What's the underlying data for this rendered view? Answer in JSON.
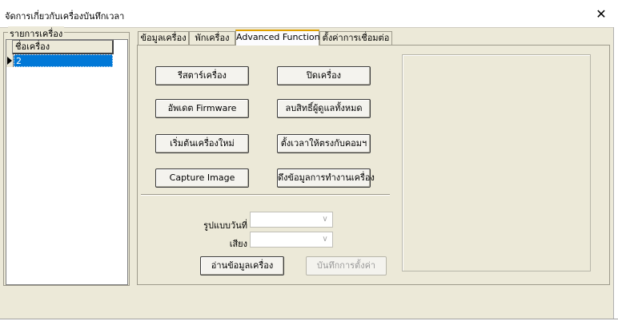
{
  "window": {
    "title": "จัดการเกี่ยวกับเครื่องบันทึกเวลา",
    "close_glyph": "✕"
  },
  "device_list": {
    "group_label": "รายการเครื่อง",
    "column_header": "ชื่อเครื่อง",
    "rows": [
      {
        "name": "2",
        "selected": true
      }
    ]
  },
  "tabs": [
    {
      "label": "ข้อมูลเครื่อง",
      "active": false
    },
    {
      "label": "พักเครื่อง",
      "active": false
    },
    {
      "label": "Advanced Function",
      "active": true
    },
    {
      "label": "ตั้งค่าการเชื่อมต่อ",
      "active": false
    }
  ],
  "actions": {
    "restart": "รีสตาร์เครื่อง",
    "shutdown": "ปิดเครื่อง",
    "update_firmware": "อัพเดต Firmware",
    "remove_admin": "ลบสิทธิ์ผู้ดูแลทั้งหมด",
    "initialize": "เริ่มต้นเครื่องใหม่",
    "sync_time": "ตั้งเวลาให้ตรงกับคอมฯ",
    "capture_image": "Capture Image",
    "work_data": "ดึงข้อมูลการทำงานเครื่อง"
  },
  "settings": {
    "date_format_label": "รูปแบบวันที่",
    "date_format_value": "",
    "sound_label": "เสียง",
    "sound_value": "",
    "read_button": "อ่านข้อมูลเครื่อง",
    "save_button": "บันทึกการตั้งค่า",
    "save_disabled": true
  }
}
